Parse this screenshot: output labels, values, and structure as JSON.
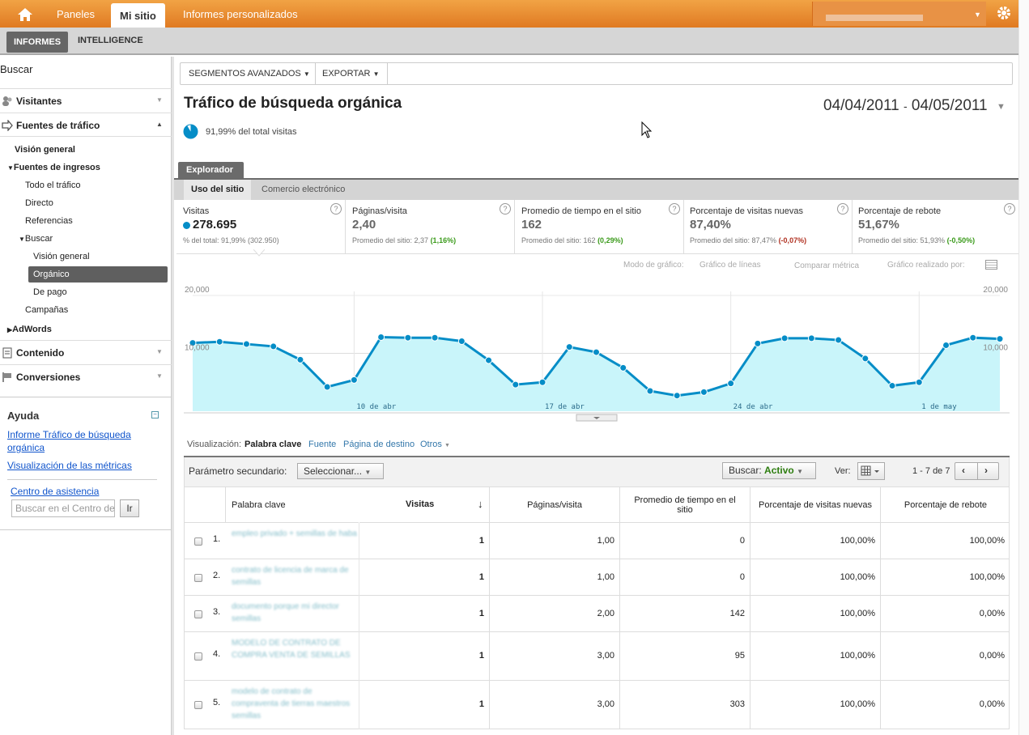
{
  "topnav": {
    "tabs": [
      {
        "label": "Paneles"
      },
      {
        "label": "Mi sitio"
      },
      {
        "label": "Informes personalizados"
      }
    ]
  },
  "subnav": {
    "tabs": [
      {
        "label": "INFORMES"
      },
      {
        "label": "INTELLIGENCE"
      }
    ]
  },
  "sidebar": {
    "search_label": "Buscar",
    "sections": [
      {
        "label": "Visitantes"
      },
      {
        "label": "Fuentes de tráfico"
      },
      {
        "label": "Contenido"
      },
      {
        "label": "Conversiones"
      }
    ],
    "items": [
      "Visión general",
      "Fuentes de ingresos",
      "Todo el tráfico",
      "Directo",
      "Referencias",
      "Buscar",
      "Visión general",
      "Orgánico",
      "De pago",
      "Campañas",
      "AdWords"
    ]
  },
  "help": {
    "title": "Ayuda",
    "links": [
      "Informe Tráfico de búsqueda orgánica",
      "Visualización de las métricas"
    ],
    "center_link": "Centro de asistencia",
    "search_placeholder": "Buscar en el Centro de asistencia",
    "go_button": "Ir"
  },
  "toolbar": {
    "segments": "SEGMENTOS AVANZADOS",
    "export": "EXPORTAR"
  },
  "report": {
    "title": "Tráfico de búsqueda orgánica",
    "date_start": "04/04/2011",
    "date_sep": "-",
    "date_end": "04/05/2011",
    "pct_total": "91,99% del total visitas"
  },
  "explorer": {
    "tab": "Explorador",
    "subtabs": [
      "Uso del sitio",
      "Comercio electrónico"
    ]
  },
  "metrics": [
    {
      "name": "Visitas",
      "value": "278.695",
      "sub_pre": "% del total: 91,99% (302.950)",
      "sub_delta": "",
      "delta_class": ""
    },
    {
      "name": "Páginas/visita",
      "value": "2,40",
      "sub_pre": "Promedio del sitio: 2,37 ",
      "sub_delta": "(1,16%)",
      "delta_class": "green"
    },
    {
      "name": "Promedio de tiempo en el sitio",
      "value": "162",
      "sub_pre": "Promedio del sitio: 162 ",
      "sub_delta": "(0,29%)",
      "delta_class": "green"
    },
    {
      "name": "Porcentaje de visitas nuevas",
      "value": "87,40%",
      "sub_pre": "Promedio del sitio: 87,47% ",
      "sub_delta": "(-0,07%)",
      "delta_class": "red"
    },
    {
      "name": "Porcentaje de rebote",
      "value": "51,67%",
      "sub_pre": "Promedio del sitio: 51,93% ",
      "sub_delta": "(-0,50%)",
      "delta_class": "green"
    }
  ],
  "chart_controls": {
    "mode_label": "Modo de gráfico:",
    "mode_value": "Gráfico de líneas",
    "compare": "Comparar métrica",
    "by": "Gráfico realizado por:"
  },
  "chart_data": {
    "type": "area",
    "x": [
      "2011-04-04",
      "2011-04-05",
      "2011-04-06",
      "2011-04-07",
      "2011-04-08",
      "2011-04-09",
      "2011-04-10",
      "2011-04-11",
      "2011-04-12",
      "2011-04-13",
      "2011-04-14",
      "2011-04-15",
      "2011-04-16",
      "2011-04-17",
      "2011-04-18",
      "2011-04-19",
      "2011-04-20",
      "2011-04-21",
      "2011-04-22",
      "2011-04-23",
      "2011-04-24",
      "2011-04-25",
      "2011-04-26",
      "2011-04-27",
      "2011-04-28",
      "2011-04-29",
      "2011-04-30",
      "2011-05-01",
      "2011-05-02",
      "2011-05-03",
      "2011-05-04",
      "2011-05-05"
    ],
    "series": [
      {
        "values": [
          11800,
          12000,
          11600,
          11200,
          8900,
          4200,
          5400,
          12800,
          12700,
          12700,
          12100,
          8800,
          4600,
          5000,
          11100,
          10200,
          7500,
          3500,
          2700,
          3300,
          4800,
          11700,
          12600,
          12600,
          12300,
          9100,
          4400,
          5000,
          11400,
          12700,
          12500
        ]
      }
    ],
    "ylim": [
      0,
      20000
    ],
    "yticks": [
      "20,000",
      "10,000"
    ],
    "xtick_labels": [
      "10 de abr",
      "17 de abr",
      "24 de abr",
      "1 de may"
    ],
    "color": "#058dc7",
    "fill": "#c9f5fa"
  },
  "viz": {
    "label": "Visualización:",
    "options": [
      "Palabra clave",
      "Fuente",
      "Página de destino",
      "Otros"
    ]
  },
  "table": {
    "secondary_label": "Parámetro secundario:",
    "secondary_value": "Seleccionar...",
    "search_label": "Buscar:",
    "search_state": "Activo",
    "view_label": "Ver:",
    "pagination": "1 - 7 de 7",
    "columns": [
      "Palabra clave",
      "Visitas",
      "Páginas/visita",
      "Promedio de tiempo en el sitio",
      "Porcentaje de visitas nuevas",
      "Porcentaje de rebote"
    ],
    "rows": [
      {
        "n": "1.",
        "kw": "empleo privado + semillas de haba",
        "visits": "1",
        "ppv": "1,00",
        "time": "0",
        "new": "100,00%",
        "bounce": "100,00%"
      },
      {
        "n": "2.",
        "kw": "contrato de licencia de marca de semillas",
        "visits": "1",
        "ppv": "1,00",
        "time": "0",
        "new": "100,00%",
        "bounce": "100,00%"
      },
      {
        "n": "3.",
        "kw": "documento porque mi director semillas",
        "visits": "1",
        "ppv": "2,00",
        "time": "142",
        "new": "100,00%",
        "bounce": "0,00%"
      },
      {
        "n": "4.",
        "kw": "MODELO DE CONTRATO DE COMPRA VENTA DE SEMILLAS",
        "visits": "1",
        "ppv": "3,00",
        "time": "95",
        "new": "100,00%",
        "bounce": "0,00%"
      },
      {
        "n": "5.",
        "kw": "modelo de contrato de compraventa de tierras maestros semillas",
        "visits": "1",
        "ppv": "3,00",
        "time": "303",
        "new": "100,00%",
        "bounce": "0,00%"
      }
    ]
  }
}
